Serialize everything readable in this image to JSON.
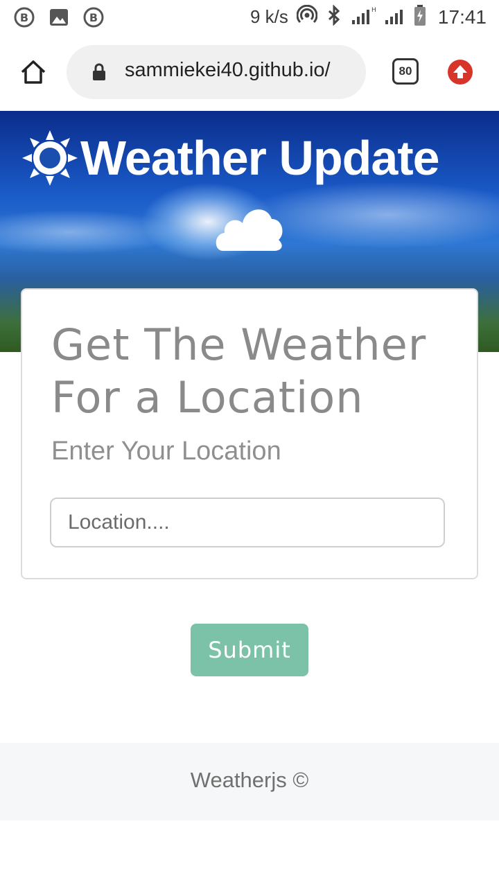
{
  "status_bar": {
    "speed": "9 k/s",
    "time": "17:41",
    "icons": [
      "bitcoin-icon",
      "image-icon",
      "bitcoin-icon",
      "hotspot-icon",
      "bluetooth-icon",
      "signal-icon",
      "signal-icon",
      "battery-icon"
    ]
  },
  "browser": {
    "url": "sammiekei40.github.io/",
    "tab_count": "80"
  },
  "hero": {
    "title": "Weather Update"
  },
  "card": {
    "title": "Get The Weather For a Location",
    "subtitle": "Enter Your Location",
    "input_placeholder": "Location....",
    "input_value": ""
  },
  "submit_label": "Submit",
  "footer": {
    "text": "Weatherjs ©"
  },
  "colors": {
    "submit_bg": "#7cc2a8",
    "update_badge": "#d8352a",
    "title_gray": "#8a8a8a"
  }
}
